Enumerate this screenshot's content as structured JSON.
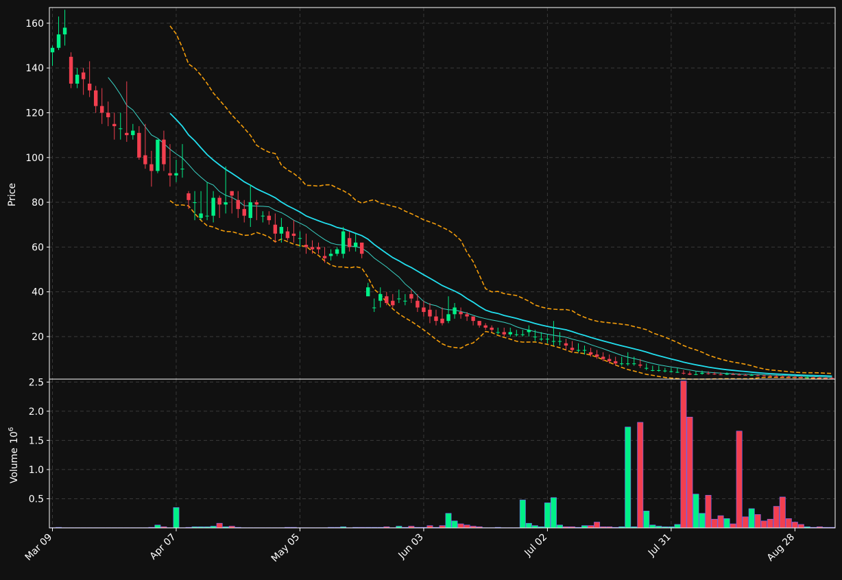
{
  "chart_data": {
    "type": "candlestick",
    "price_panel": {
      "ylabel": "Price",
      "yticks": [
        20,
        40,
        60,
        80,
        100,
        120,
        140,
        160
      ],
      "ylim": [
        1,
        167
      ],
      "grid": true
    },
    "volume_panel": {
      "ylabel": "Volume",
      "ylabel_exponent": "10",
      "ylabel_power": "6",
      "yticks": [
        0.5,
        1.0,
        1.5,
        2.0,
        2.5
      ],
      "ytick_labels": [
        "0.5",
        "1.0",
        "1.5",
        "2.0",
        "2.5"
      ],
      "ylim": [
        0,
        2.55
      ],
      "grid": true
    },
    "xtick_labels": [
      {
        "index": 0,
        "label": "Mar 09"
      },
      {
        "index": 20,
        "label": "Apr 07"
      },
      {
        "index": 40,
        "label": "May 05"
      },
      {
        "index": 60,
        "label": "Jun 03"
      },
      {
        "index": 80,
        "label": "Jul 02"
      },
      {
        "index": 100,
        "label": "Jul 31"
      },
      {
        "index": 120,
        "label": "Aug 28"
      }
    ],
    "n_bars": 127,
    "colors": {
      "background": "#111111",
      "up": "#00f087",
      "down": "#f23f4f",
      "ma_short": "#3ad4c6",
      "ma_long": "#22e0f0",
      "bands": "#f59e0b",
      "grid": "#3a3a3a",
      "spine": "#ffffff"
    },
    "series": {
      "close": [
        149,
        155,
        158,
        133,
        137,
        135,
        130,
        123,
        120,
        118,
        114,
        113,
        110,
        112,
        100,
        97,
        94,
        108,
        97,
        92,
        93,
        95,
        81,
        80,
        75,
        74,
        82,
        79,
        80,
        83,
        77,
        74,
        80,
        79,
        74,
        72,
        66,
        69,
        64,
        65,
        64,
        60,
        59,
        59,
        55,
        57,
        59,
        67,
        60,
        62,
        57,
        42,
        33,
        39,
        35,
        34,
        37,
        36,
        37,
        33,
        31,
        29,
        27,
        26,
        30,
        33,
        30,
        29,
        27,
        25,
        24,
        23,
        22,
        21,
        22,
        21,
        21,
        23,
        20,
        19,
        19,
        18,
        18,
        16,
        14,
        14,
        14,
        12,
        11,
        10,
        9,
        8,
        8,
        8,
        8,
        7,
        6,
        5,
        5,
        4.8,
        4.5,
        4.2,
        3.5,
        3,
        3.2,
        3.8,
        3.5,
        3.2,
        3,
        3.3,
        3.1,
        2.9,
        2.7,
        2.8,
        2.6,
        2.5,
        2.3,
        2.2,
        2.1,
        2,
        1.9,
        1.8,
        1.8,
        1.7,
        1.6,
        1.5,
        1.4
      ],
      "open": [
        147,
        149,
        155,
        145,
        133,
        138,
        133,
        130,
        123,
        120,
        115,
        113,
        111,
        110,
        111,
        101,
        97,
        94,
        108,
        93,
        92,
        95,
        84,
        80,
        73,
        74,
        74,
        82,
        79,
        85,
        81,
        77,
        73,
        80,
        74,
        74,
        70,
        66,
        67,
        66,
        64,
        61,
        60,
        60,
        56,
        56,
        57,
        57,
        64,
        60,
        62,
        38,
        33,
        36,
        38,
        36,
        37,
        36,
        39,
        36,
        33,
        32,
        29,
        28,
        27,
        30,
        31,
        30,
        29,
        27,
        25,
        24,
        22,
        22,
        21,
        21,
        21,
        22,
        20,
        19,
        19,
        18,
        18,
        17,
        15,
        14,
        14,
        13,
        12,
        11,
        10,
        9,
        8,
        8,
        8,
        7.5,
        6,
        5,
        5,
        4.8,
        4.5,
        4.2,
        3.8,
        3.5,
        3,
        3.4,
        3.6,
        3.4,
        3.1,
        3,
        3.2,
        3,
        2.8,
        2.7,
        2.7,
        2.6,
        2.4,
        2.3,
        2.2,
        2.1,
        2,
        1.9,
        1.8,
        1.8,
        1.7,
        1.6,
        1.5
      ],
      "high": [
        150,
        163,
        166,
        147,
        140,
        140,
        143,
        132,
        131,
        125,
        120,
        120,
        134,
        115,
        114,
        115,
        103,
        105,
        112,
        106,
        99,
        106,
        85,
        85,
        85,
        89,
        85,
        83,
        96,
        85,
        85,
        81,
        88,
        81,
        76,
        76,
        75,
        73,
        69,
        72,
        67,
        66,
        63,
        62,
        60,
        59,
        60,
        69,
        67,
        66,
        60,
        44,
        37,
        42,
        40,
        39,
        41,
        39,
        41,
        39,
        36,
        35,
        32,
        33,
        38,
        35,
        33,
        31,
        29,
        27,
        26,
        25,
        24,
        24,
        24,
        23,
        23,
        25,
        23,
        22,
        21,
        27,
        22,
        19,
        18,
        17,
        16,
        15,
        14,
        13,
        12,
        11,
        11,
        13,
        11,
        10,
        8,
        7,
        7,
        6,
        6,
        6,
        5,
        4.5,
        4.5,
        4.8,
        4.5,
        4.2,
        4,
        4,
        3.8,
        3.6,
        3.4,
        3.4,
        3.2,
        3.1,
        3,
        2.9,
        2.7,
        2.6,
        2.5,
        2.4,
        2.3,
        2.2,
        2.1,
        2,
        1.9
      ],
      "low": [
        141,
        148,
        150,
        131,
        131,
        128,
        127,
        120,
        115,
        114,
        108,
        108,
        107,
        108,
        99,
        95,
        87,
        93,
        94,
        87,
        89,
        91,
        77,
        72,
        72,
        72,
        71,
        73,
        75,
        75,
        73,
        71,
        69,
        72,
        71,
        70,
        62,
        62,
        63,
        62,
        60,
        57,
        57,
        57,
        53,
        54,
        56,
        55,
        58,
        58,
        55,
        39,
        31,
        33,
        34,
        33,
        35,
        34,
        35,
        31,
        29,
        26,
        25,
        25,
        26,
        28,
        28,
        27,
        25,
        24,
        23,
        22,
        21,
        20,
        20,
        20,
        20,
        20,
        18,
        18,
        17,
        16,
        16,
        14,
        13,
        13,
        12,
        11,
        10,
        9,
        8,
        7,
        7,
        7,
        7,
        6,
        5,
        4.5,
        4.3,
        4,
        4,
        3.8,
        3,
        2.8,
        2.8,
        3,
        3,
        2.9,
        2.7,
        2.8,
        2.8,
        2.6,
        2.5,
        2.5,
        2.3,
        2.2,
        2.1,
        2,
        1.9,
        1.8,
        1.7,
        1.6,
        1.6,
        1.5,
        1.4,
        1.3,
        1.2
      ],
      "volume": [
        0.005,
        0.01,
        0.005,
        0.005,
        0.005,
        0.005,
        0.005,
        0.005,
        0.005,
        0.005,
        0.005,
        0.005,
        0.005,
        0.005,
        0.005,
        0.005,
        0.01,
        0.05,
        0.02,
        0.005,
        0.35,
        0.005,
        0.01,
        0.02,
        0.02,
        0.02,
        0.03,
        0.08,
        0.02,
        0.03,
        0.01,
        0.005,
        0.005,
        0.005,
        0.005,
        0.005,
        0.005,
        0.005,
        0.01,
        0.01,
        0.005,
        0.005,
        0.005,
        0.005,
        0.005,
        0.01,
        0.01,
        0.02,
        0.005,
        0.01,
        0.01,
        0.01,
        0.01,
        0.01,
        0.02,
        0.005,
        0.03,
        0.01,
        0.03,
        0.01,
        0.01,
        0.04,
        0.01,
        0.04,
        0.25,
        0.12,
        0.07,
        0.05,
        0.03,
        0.02,
        0.005,
        0.005,
        0.01,
        0.005,
        0.005,
        0.005,
        0.48,
        0.08,
        0.04,
        0.02,
        0.43,
        0.52,
        0.05,
        0.02,
        0.02,
        0.01,
        0.04,
        0.04,
        0.1,
        0.02,
        0.02,
        0.01,
        0.02,
        1.73,
        0.02,
        1.81,
        0.29,
        0.05,
        0.03,
        0.02,
        0.02,
        0.06,
        2.52,
        1.9,
        0.58,
        0.25,
        0.56,
        0.15,
        0.21,
        0.16,
        0.07,
        1.66,
        0.19,
        0.33,
        0.23,
        0.12,
        0.15,
        0.37,
        0.53,
        0.16,
        0.1,
        0.06,
        0.02,
        0.01,
        0.02,
        0.01,
        0.01,
        0.02,
        0.08
      ]
    },
    "overlays": [
      {
        "kind": "ma_short",
        "start": 9
      },
      {
        "kind": "ma_long",
        "start": 19
      },
      {
        "kind": "band_upper",
        "start": 19
      },
      {
        "kind": "band_lower",
        "start": 19
      }
    ]
  }
}
